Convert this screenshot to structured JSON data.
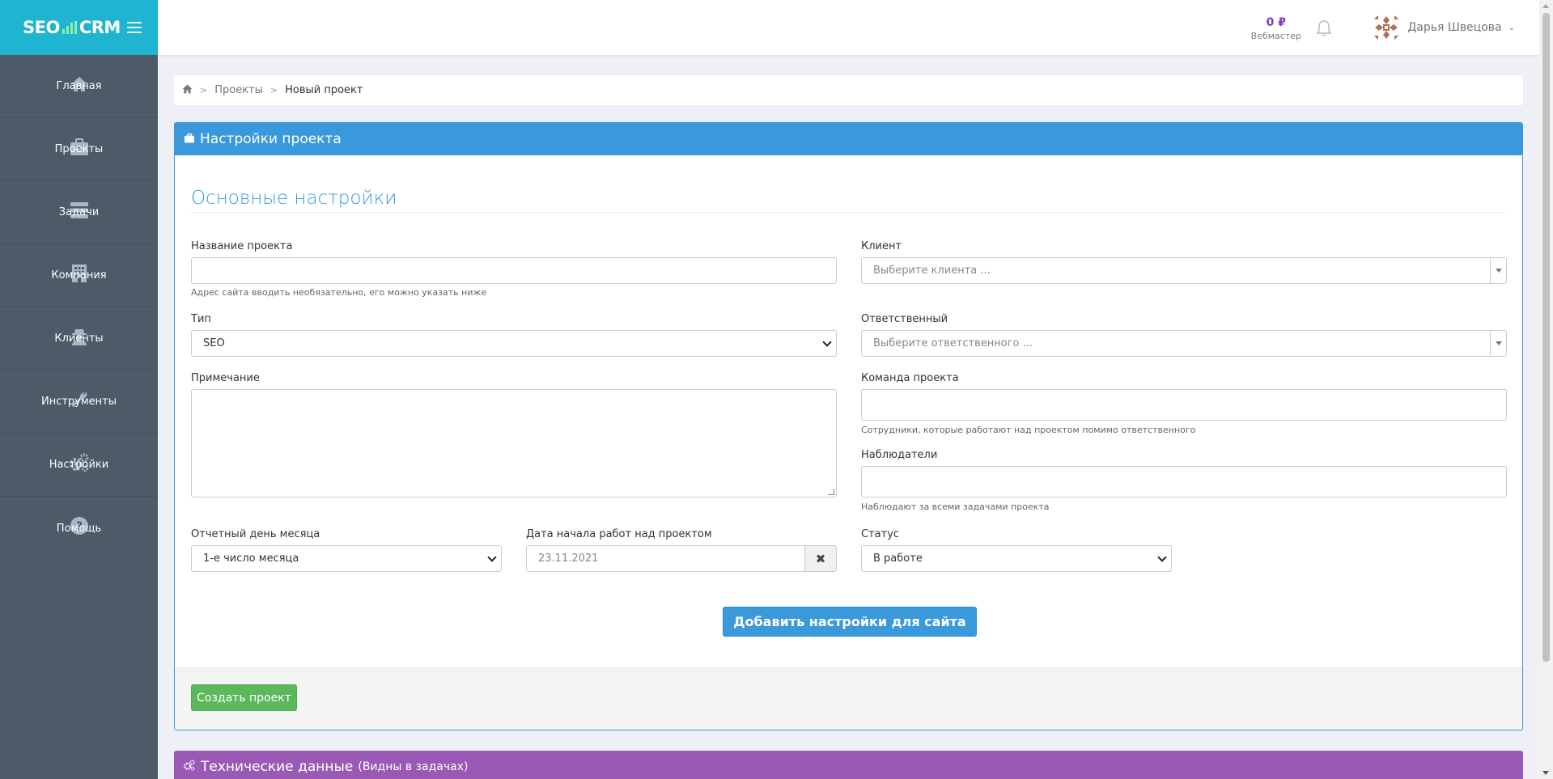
{
  "brand": {
    "logo_left": "SEO",
    "logo_right": "CRM",
    "accent_color": "#1fb5d1"
  },
  "sidebar": {
    "items": [
      {
        "label": "Главная",
        "icon": "home-icon"
      },
      {
        "label": "Проекты",
        "icon": "briefcase-icon"
      },
      {
        "label": "Задачи",
        "icon": "tasks-icon"
      },
      {
        "label": "Компания",
        "icon": "building-icon"
      },
      {
        "label": "Клиенты",
        "icon": "user-secret-icon"
      },
      {
        "label": "Инструменты",
        "icon": "wrench-icon"
      },
      {
        "label": "Настройки",
        "icon": "cogs-icon"
      },
      {
        "label": "Помощь",
        "icon": "question-circle-icon"
      }
    ]
  },
  "topbar": {
    "balance": "0 ₽",
    "role": "Вебмастер",
    "user_name": "Дарья Швецова"
  },
  "breadcrumb": {
    "items": [
      "Проекты"
    ],
    "current": "Новый проект"
  },
  "panel": {
    "title": "Настройки проекта",
    "section_title": "Основные настройки",
    "fields": {
      "project_name": {
        "label": "Название проекта",
        "value": "",
        "help": "Адрес сайта вводить необязательно, его можно указать ниже"
      },
      "type": {
        "label": "Тип",
        "value": "SEO"
      },
      "note": {
        "label": "Примечание",
        "value": ""
      },
      "report_day": {
        "label": "Отчетный день месяца",
        "value": "1-е число месяца"
      },
      "start_date": {
        "label": "Дата начала работ над проектом",
        "value": "23.11.2021"
      },
      "client": {
        "label": "Клиент",
        "placeholder": "Выберите клиента ..."
      },
      "responsible": {
        "label": "Ответственный",
        "placeholder": "Выберите ответственного ..."
      },
      "team": {
        "label": "Команда проекта",
        "value": "",
        "help": "Сотрудники, которые работают над проектом помимо ответственного"
      },
      "observers": {
        "label": "Наблюдатели",
        "value": "",
        "help": "Наблюдают за всеми задачами проекта"
      },
      "status": {
        "label": "Статус",
        "value": "В работе"
      }
    },
    "add_site_button": "Добавить настройки для сайта",
    "create_button": "Создать проект"
  },
  "panel2": {
    "title": "Технические данные",
    "subtitle": "(Видны в задачах)"
  },
  "colors": {
    "primary": "#3a99db",
    "success": "#5cb85c",
    "purple": "#9b59b6",
    "sidebar": "#4d5b69"
  }
}
